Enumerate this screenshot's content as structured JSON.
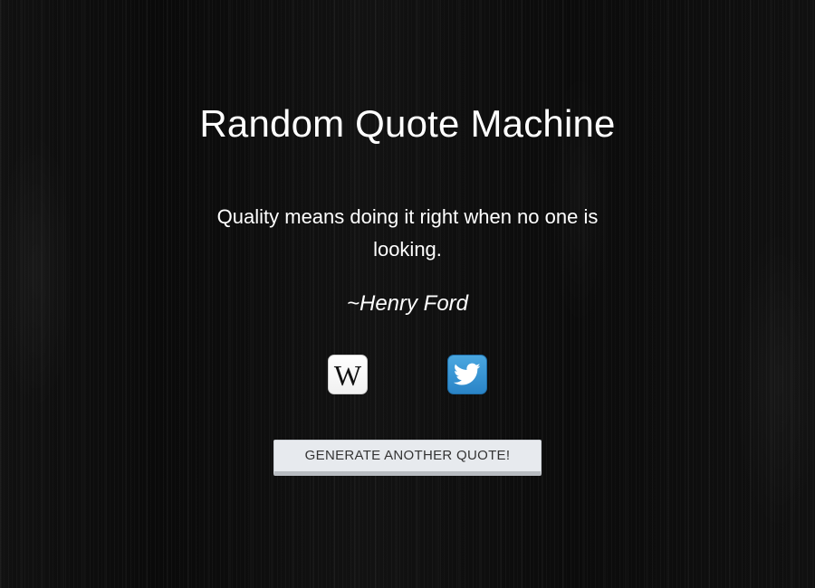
{
  "page": {
    "title": "Random Quote Machine"
  },
  "quote": {
    "text": "Quality means doing it right when no one is looking.",
    "author": "~Henry Ford"
  },
  "share": {
    "wikipedia": {
      "icon": "wikipedia-icon",
      "glyph": "W"
    },
    "twitter": {
      "icon": "twitter-icon",
      "color": "#2f8fd0"
    }
  },
  "actions": {
    "generate_label": "GENERATE ANOTHER QUOTE!"
  },
  "colors": {
    "background": "#0b0b0b",
    "text": "#ffffff",
    "button_bg": "#e7eaee",
    "button_text": "#333333"
  }
}
